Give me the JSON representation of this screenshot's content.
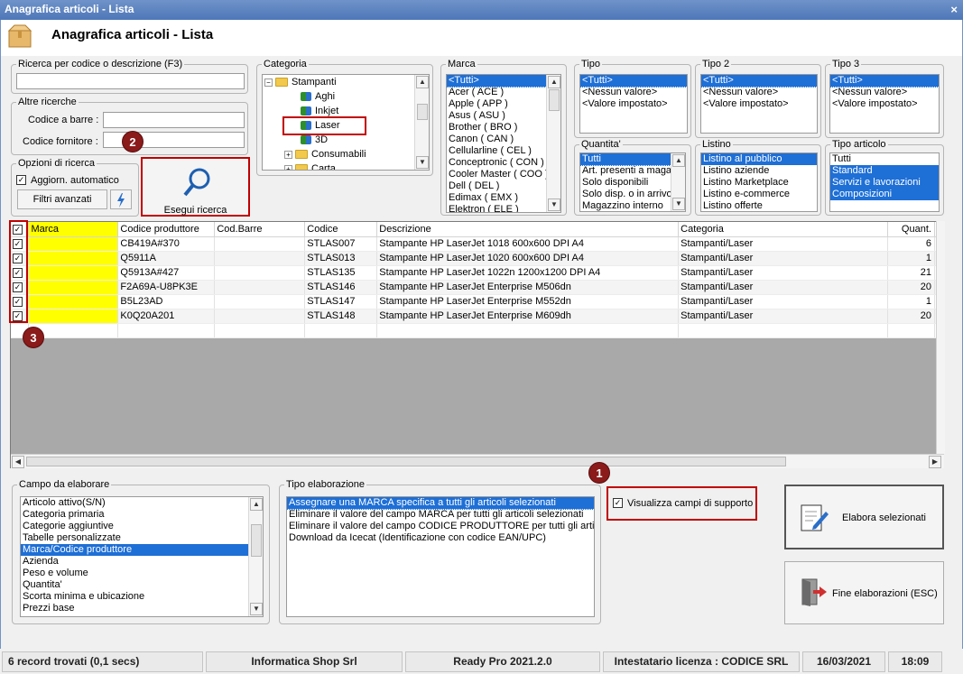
{
  "window": {
    "title": "Anagrafica articoli  - Lista",
    "header_title": "Anagrafica articoli  - Lista",
    "close": "×"
  },
  "search": {
    "group_title": "Ricerca per codice o descrizione (F3)",
    "value": "",
    "other_title": "Altre ricerche",
    "barcode_label": "Codice a barre :",
    "supplier_label": "Codice fornitore :",
    "options_title": "Opzioni di ricerca",
    "auto_update_label": "Aggiorn. automatico",
    "advanced_filters": "Filtri avanzati",
    "run_search": "Esegui ricerca"
  },
  "categoria": {
    "title": "Categoria",
    "items": [
      {
        "label": "Stampanti",
        "type": "folder-open"
      },
      {
        "label": "Aghi",
        "type": "leaf"
      },
      {
        "label": "Inkjet",
        "type": "leaf"
      },
      {
        "label": "Laser",
        "type": "leaf"
      },
      {
        "label": "3D",
        "type": "leaf"
      },
      {
        "label": "Consumabili",
        "type": "folder"
      },
      {
        "label": "Carta",
        "type": "folder"
      }
    ]
  },
  "marca": {
    "title": "Marca",
    "items": [
      "<Tutti>",
      "Acer ( ACE )",
      "Apple ( APP )",
      "Asus ( ASU )",
      "Brother ( BRO )",
      "Canon ( CAN )",
      "Cellularline ( CEL )",
      "Conceptronic ( CON )",
      "Cooler Master ( COO )",
      "Dell ( DEL )",
      "Edimax ( EMX )",
      "Elektron ( ELE )"
    ]
  },
  "tipo": {
    "title": "Tipo",
    "items": [
      "<Tutti>",
      "<Nessun valore>",
      "<Valore impostato>"
    ]
  },
  "tipo2": {
    "title": "Tipo 2",
    "items": [
      "<Tutti>",
      "<Nessun valore>",
      "<Valore impostato>"
    ]
  },
  "tipo3": {
    "title": "Tipo 3",
    "items": [
      "<Tutti>",
      "<Nessun valore>",
      "<Valore impostato>"
    ]
  },
  "quantita": {
    "title": "Quantita'",
    "items": [
      "Tutti",
      "Art. presenti a magazzino",
      "Solo disponibili",
      "Solo disp. o in arrivo",
      "Magazzino interno"
    ]
  },
  "listino": {
    "title": "Listino",
    "items": [
      "Listino al pubblico",
      "Listino aziende",
      "Listino Marketplace",
      "Listino e-commerce",
      "Listino offerte"
    ]
  },
  "tipo_articolo": {
    "title": "Tipo articolo",
    "items": [
      "Tutti",
      "Standard",
      "Servizi e lavorazioni",
      "Composizioni"
    ]
  },
  "grid": {
    "columns": [
      "Marca",
      "Codice produttore",
      "Cod.Barre",
      "Codice",
      "Descrizione",
      "Categoria",
      "Quant."
    ],
    "rows": [
      {
        "checked": true,
        "marca": "",
        "cod_prod": "CB419A#370",
        "barre": "",
        "codice": "STLAS007",
        "descr": "Stampante HP LaserJet 1018 600x600 DPI A4",
        "cat": "Stampanti/Laser",
        "qty": "6"
      },
      {
        "checked": true,
        "marca": "",
        "cod_prod": "Q5911A",
        "barre": "",
        "codice": "STLAS013",
        "descr": "Stampante HP LaserJet 1020 600x600 DPI A4",
        "cat": "Stampanti/Laser",
        "qty": "1"
      },
      {
        "checked": true,
        "marca": "",
        "cod_prod": "Q5913A#427",
        "barre": "",
        "codice": "STLAS135",
        "descr": "Stampante HP LaserJet 1022n 1200x1200 DPI A4",
        "cat": "Stampanti/Laser",
        "qty": "21"
      },
      {
        "checked": true,
        "marca": "",
        "cod_prod": "F2A69A-U8PK3E",
        "barre": "",
        "codice": "STLAS146",
        "descr": "Stampante HP LaserJet Enterprise M506dn",
        "cat": "Stampanti/Laser",
        "qty": "20"
      },
      {
        "checked": true,
        "marca": "",
        "cod_prod": "B5L23AD",
        "barre": "",
        "codice": "STLAS147",
        "descr": "Stampante HP LaserJet Enterprise M552dn",
        "cat": "Stampanti/Laser",
        "qty": "1"
      },
      {
        "checked": true,
        "marca": "",
        "cod_prod": "K0Q20A201",
        "barre": "",
        "codice": "STLAS148",
        "descr": "Stampante HP LaserJet Enterprise M609dh",
        "cat": "Stampanti/Laser",
        "qty": "20"
      }
    ]
  },
  "campo": {
    "title": "Campo da elaborare",
    "items": [
      "Articolo attivo(S/N)",
      "Categoria primaria",
      "Categorie aggiuntive",
      "Tabelle personalizzate",
      "Marca/Codice produttore",
      "Azienda",
      "Peso e volume",
      "Quantita'",
      "Scorta minima e ubicazione",
      "Prezzi base"
    ]
  },
  "elaborazione": {
    "title": "Tipo elaborazione",
    "items": [
      "Assegnare una MARCA specifica a tutti gli articoli selezionati",
      "Eliminare il valore del campo MARCA per tutti gli articoli selezionati",
      "Eliminare il valore del campo CODICE PRODUTTORE per tutti gli articoli",
      "Download da Icecat (Identificazione con codice EAN/UPC)"
    ]
  },
  "support": {
    "label": "Visualizza campi di supporto"
  },
  "actions": {
    "elabora": "Elabora selezionati",
    "fine": "Fine elaborazioni (ESC)"
  },
  "badges": {
    "b1": "1",
    "b2": "2",
    "b3": "3"
  },
  "status": {
    "records": "6 record trovati (0,1 secs)",
    "company": "Informatica Shop Srl",
    "version": "Ready Pro 2021.2.0",
    "license": "Intestatario licenza : CODICE SRL",
    "date": "16/03/2021",
    "time": "18:09"
  }
}
